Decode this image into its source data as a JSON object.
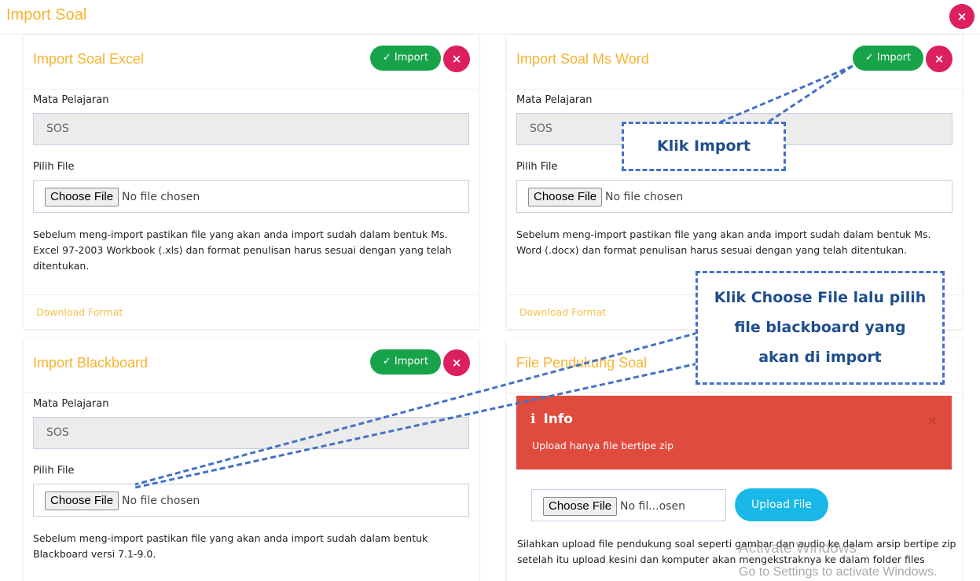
{
  "modal": {
    "title": "Import Soal",
    "close_label": "×"
  },
  "common": {
    "import_label": "✓ Import",
    "close_label": "×",
    "mata_pelajaran_label": "Mata Pelajaran",
    "pilih_file_label": "Pilih File",
    "subject_value": "SOS",
    "choose_file_label": "Choose File",
    "no_file_label": "No file chosen",
    "download_format_label": "Download Format"
  },
  "excel": {
    "title": "Import Soal Excel",
    "desc": "Sebelum meng-import pastikan file yang akan anda import sudah dalam bentuk Ms. Excel 97-2003 Workbook (.xls) dan format penulisan harus sesuai dengan yang telah ditentukan."
  },
  "word": {
    "title": "Import Soal Ms Word",
    "desc": "Sebelum meng-import pastikan file yang akan anda import sudah dalam bentuk Ms. Word (.docx) dan format penulisan harus sesuai dengan yang telah ditentukan."
  },
  "blackboard": {
    "title": "Import Blackboard",
    "desc": "Sebelum meng-import pastikan file yang akan anda import sudah dalam bentuk Blackboard versi 7.1-9.0."
  },
  "pendukung": {
    "title": "File Pendukung Soal",
    "alert_title": "Info",
    "alert_icon": "i",
    "alert_close": "×",
    "alert_message": "Upload hanya file bertipe zip",
    "no_file_label": "No fil...osen",
    "upload_label": "Upload File",
    "desc": "Silahkan upload file pendukung soal seperti gambar dan audio ke dalam arsip bertipe zip setelah itu upload kesini dan komputer akan mengekstraknya ke dalam folder files"
  },
  "annotations": {
    "import_callout": "Klik Import",
    "choose_callout": "Klik Choose File lalu pilih file blackboard yang akan di import"
  },
  "watermark": {
    "line1": "Activate Windows",
    "line2": "Go to Settings to activate Windows."
  },
  "colors": {
    "accent": "#f5b431",
    "import_green": "#17a34a",
    "close_pink": "#dc1f5e",
    "alert_red": "#df4b3d",
    "upload_blue": "#19b8e8",
    "annotation_blue": "#4472c4"
  }
}
